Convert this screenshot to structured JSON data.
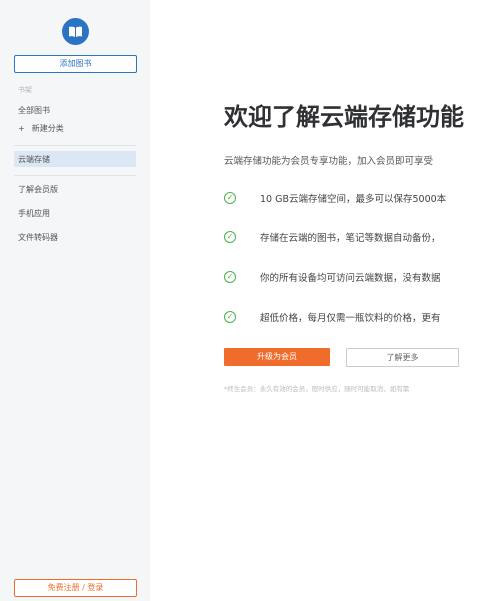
{
  "sidebar": {
    "add_book": "添加图书",
    "section_label": "书架",
    "all_books": "全部图书",
    "new_category": "新建分类",
    "cloud_storage": "云端存储",
    "learn_membership": "了解会员版",
    "mobile_app": "手机应用",
    "file_converter": "文件转码器",
    "login": "免费注册 / 登录",
    "plus_glyph": "+"
  },
  "main": {
    "title": "欢迎了解云端存储功能",
    "intro": "云端存储功能为会员专享功能，加入会员即可享受",
    "features": [
      "10 GB云端存储空间，最多可以保存5000本",
      "存储在云端的图书，笔记等数据自动备份，",
      "你的所有设备均可访问云端数据，没有数据",
      "超低价格，每月仅需一瓶饮料的价格，更有"
    ],
    "upgrade_button": "升级为会员",
    "learn_more_button": "了解更多",
    "footnote": "*终生会员：永久有效的会员，限时供应，随时可能取消，如有需"
  },
  "icons": {
    "logo": "book-open-icon",
    "check": "check-circle-icon"
  },
  "colors": {
    "accent_blue": "#2b73c4",
    "accent_orange": "#ef6c2c",
    "check_green": "#4cb050",
    "sidebar_bg": "#f5f6f7"
  }
}
